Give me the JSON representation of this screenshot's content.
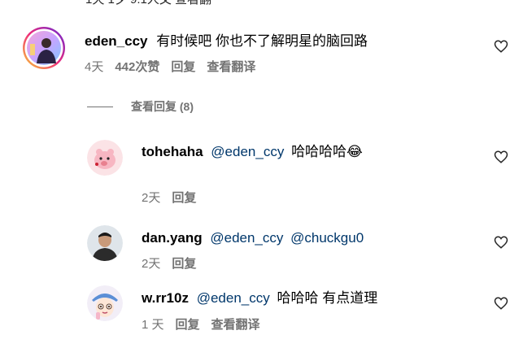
{
  "top_cut_text": "1天    1夕    9.1人文    查看翻",
  "comment": {
    "username": "eden_ccy",
    "text": "有时候吧 你也不了解明星的脑回路",
    "age": "4天",
    "likes": "442次赞",
    "reply_label": "回复",
    "translate_label": "查看翻译"
  },
  "view_replies_label": "查看回复 (8)",
  "replies": [
    {
      "username": "tohehaha",
      "mention": "@eden_ccy",
      "text": "哈哈哈哈😂",
      "age": "2天",
      "reply_label": "回复"
    },
    {
      "username": "dan.yang",
      "mention": "@eden_ccy",
      "text": "@chuckgu0",
      "age": "2天",
      "reply_label": "回复"
    },
    {
      "username": "w.rr10z",
      "mention": "@eden_ccy",
      "text": "哈哈哈 有点道理",
      "age": "1 天",
      "reply_label": "回复",
      "translate_label": "查看翻译"
    }
  ],
  "colors": {
    "secondary_text": "#737373",
    "mention": "#00376b",
    "story_ring_start": "#f9ce34",
    "story_ring_end": "#c13584"
  }
}
